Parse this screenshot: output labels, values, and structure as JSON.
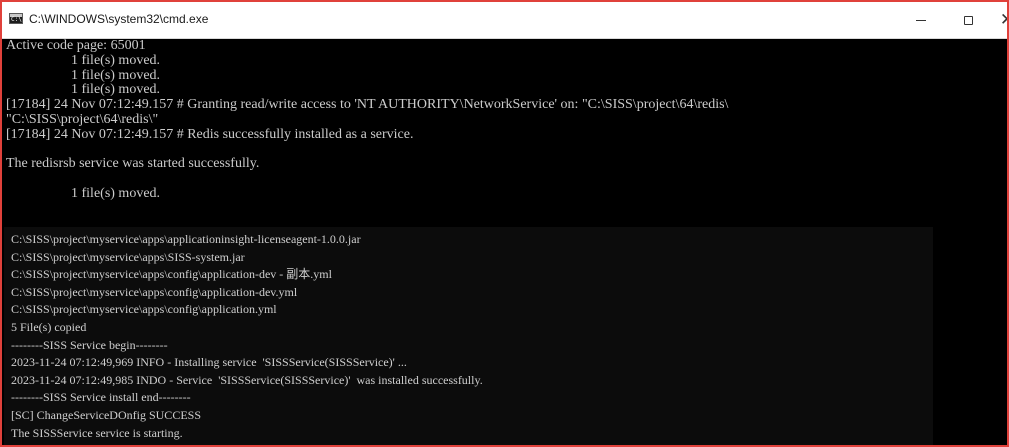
{
  "window": {
    "title": "C:\\WINDOWS\\system32\\cmd.exe",
    "icon": "cmd-icon",
    "icon_glyph": "C:\\",
    "controls": {
      "minimize": "minimize-icon",
      "maximize": "maximize-icon",
      "close_glyph": "✕"
    }
  },
  "console": {
    "lines": [
      {
        "text": "Active code page: 65001",
        "indent": false
      },
      {
        "text": "1 file(s) moved.",
        "indent": true
      },
      {
        "text": "1 file(s) moved.",
        "indent": true
      },
      {
        "text": "1 file(s) moved.",
        "indent": true
      },
      {
        "text": "[17184] 24 Nov 07:12:49.157 # Granting read/write access to 'NT AUTHORITY\\NetworkService' on: \"C:\\SISS\\project\\64\\redis\\",
        "indent": false
      },
      {
        "text": "\"C:\\SISS\\project\\64\\redis\\\"",
        "indent": false
      },
      {
        "text": "[17184] 24 Nov 07:12:49.157 # Redis successfully installed as a service.",
        "indent": false
      },
      {
        "text": "",
        "indent": false
      },
      {
        "text": "The redisrsb service was started successfully.",
        "indent": false
      },
      {
        "text": "",
        "indent": false
      },
      {
        "text": "1 file(s) moved.",
        "indent": true
      }
    ]
  },
  "overlay_console": {
    "lines": [
      "C:\\SISS\\project\\myservice\\apps\\applicationinsight-licenseagent-1.0.0.jar",
      "C:\\SISS\\project\\myservice\\apps\\SISS-system.jar",
      "C:\\SISS\\project\\myservice\\apps\\config\\application-dev - 副本.yml",
      "C:\\SISS\\project\\myservice\\apps\\config\\application-dev.yml",
      "C:\\SISS\\project\\myservice\\apps\\config\\application.yml",
      "5 File(s) copied",
      "--------SISS Service begin--------",
      "2023-11-24 07:12:49,969 INFO - Installing service  'SISSService(SISSService)' ...",
      "2023-11-24 07:12:49,985 INDO - Service  'SISSService(SISSService)'  was installed successfully.",
      "--------SISS Service install end--------",
      "[SC] ChangeServiceDOnfig SUCCESS",
      "The SISSService service is starting."
    ]
  },
  "colors": {
    "console_background": "#000000",
    "console_text": "#cccccc",
    "window_border": "#e0413b",
    "titlebar_background": "#ffffff"
  }
}
